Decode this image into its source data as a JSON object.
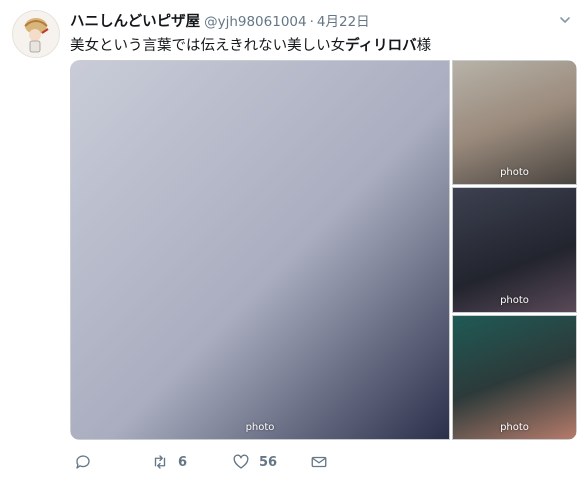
{
  "tweet": {
    "display_name": "ハニしんどいピザ屋",
    "handle": "@yjh98061004",
    "separator": "·",
    "date": "4月22日",
    "text_regular": "美女という言葉では伝えきれない美しい女",
    "text_bold": "ディリロバ",
    "text_suffix": "様"
  },
  "media": {
    "main": "photo",
    "thumb1": "photo",
    "thumb2": "photo",
    "thumb3": "photo"
  },
  "actions": {
    "reply_count": "",
    "retweet_count": "6",
    "like_count": "56"
  },
  "colors": {
    "text": "#14171a",
    "secondary": "#657786",
    "action_icon": "#657786"
  },
  "icons": [
    "avatar-illustration",
    "chevron-down-icon",
    "reply-icon",
    "retweet-icon",
    "heart-icon",
    "direct-message-icon"
  ]
}
